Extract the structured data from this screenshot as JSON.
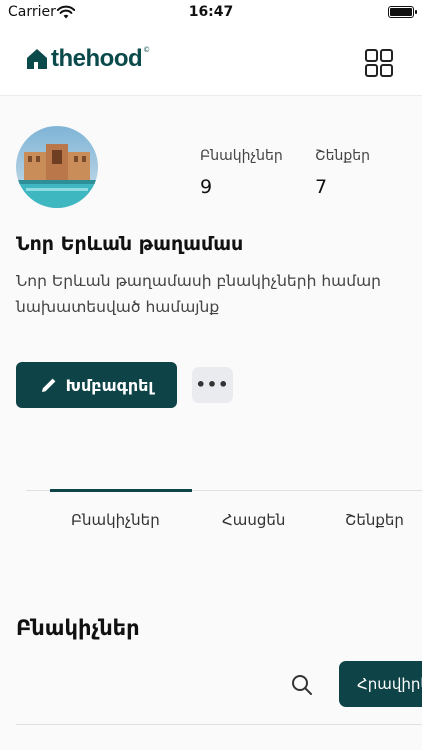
{
  "status_bar": {
    "carrier": "Carrier",
    "time": "16:47"
  },
  "brand": {
    "name": "thehood",
    "mark": "©",
    "color": "#0b4a4a"
  },
  "header": {
    "menu_icon": "grid-icon"
  },
  "profile": {
    "stats": [
      {
        "label": "Բնակիչներ",
        "value": "9"
      },
      {
        "label": "Շենքեր",
        "value": "7"
      }
    ],
    "title": "Նոր Երևան թաղամաս",
    "description": "Նոր Երևան թաղամասի բնակիչների համար նախատեսված համայնք",
    "edit_label": "Խմբագրել",
    "more_label": "•••"
  },
  "tabs": [
    "Բնակիչներ",
    "Հասցեն",
    "Շենքեր"
  ],
  "residents": {
    "title": "Բնակիչներ",
    "invite_label": "Հրավիրել"
  },
  "colors": {
    "accent": "#0e4447",
    "muted_button": "#e9ebee"
  }
}
